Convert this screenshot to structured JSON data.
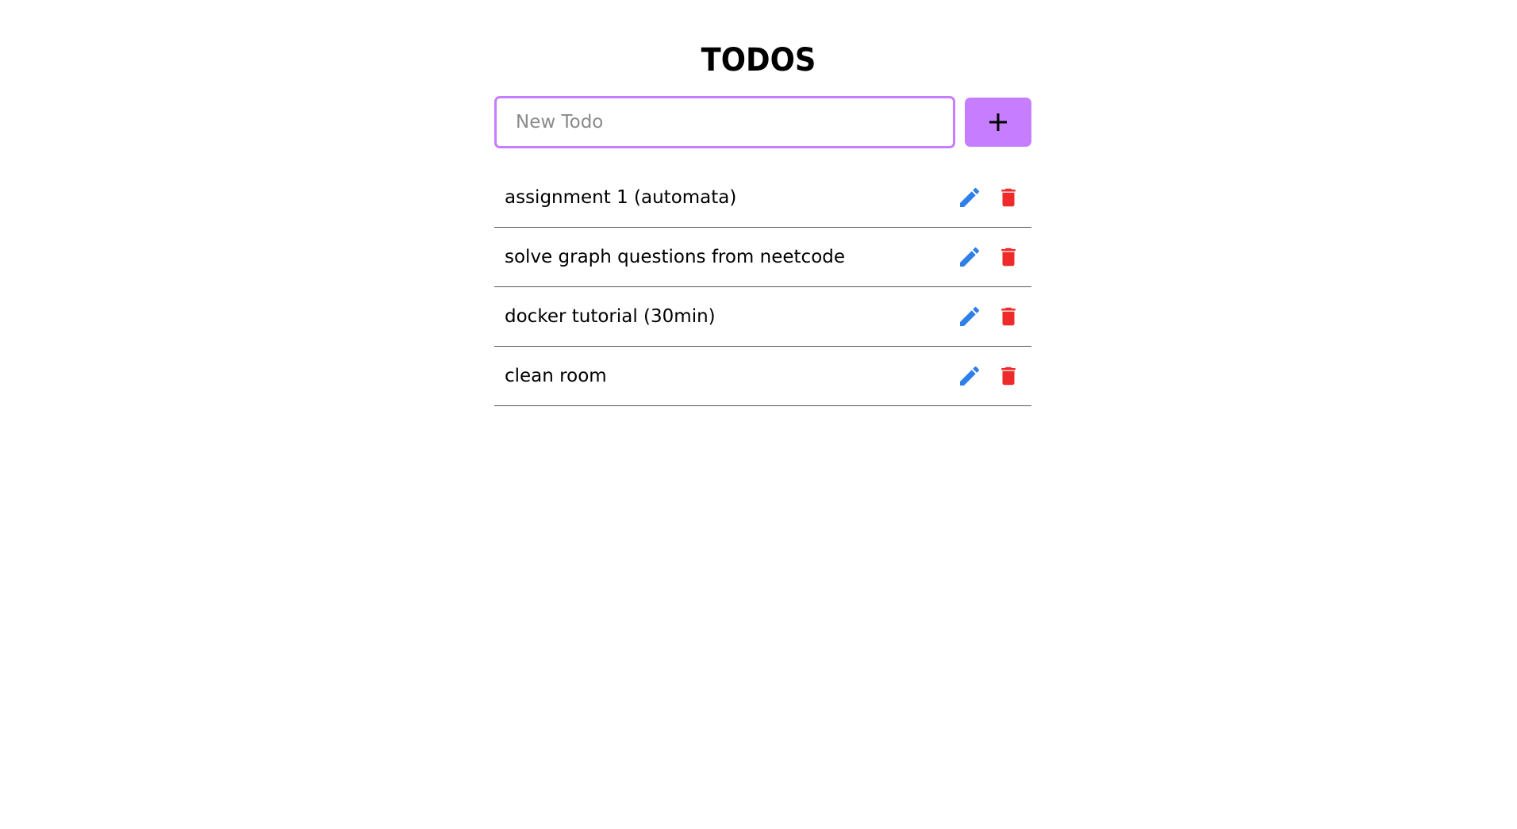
{
  "header": {
    "title": "TODOS"
  },
  "new_todo": {
    "placeholder": "New Todo",
    "value": "",
    "add_icon": "plus-icon"
  },
  "todos": [
    {
      "text": "assignment 1 (automata)",
      "edit_icon": "pencil-icon",
      "delete_icon": "trash-icon"
    },
    {
      "text": "solve graph questions from neetcode",
      "edit_icon": "pencil-icon",
      "delete_icon": "trash-icon"
    },
    {
      "text": "docker tutorial (30min)",
      "edit_icon": "pencil-icon",
      "delete_icon": "trash-icon"
    },
    {
      "text": "clean room",
      "edit_icon": "pencil-icon",
      "delete_icon": "trash-icon"
    }
  ],
  "colors": {
    "accent": "#c77dff",
    "edit": "#2f7fe8",
    "delete": "#ee2a2a",
    "divider": "#555555"
  }
}
